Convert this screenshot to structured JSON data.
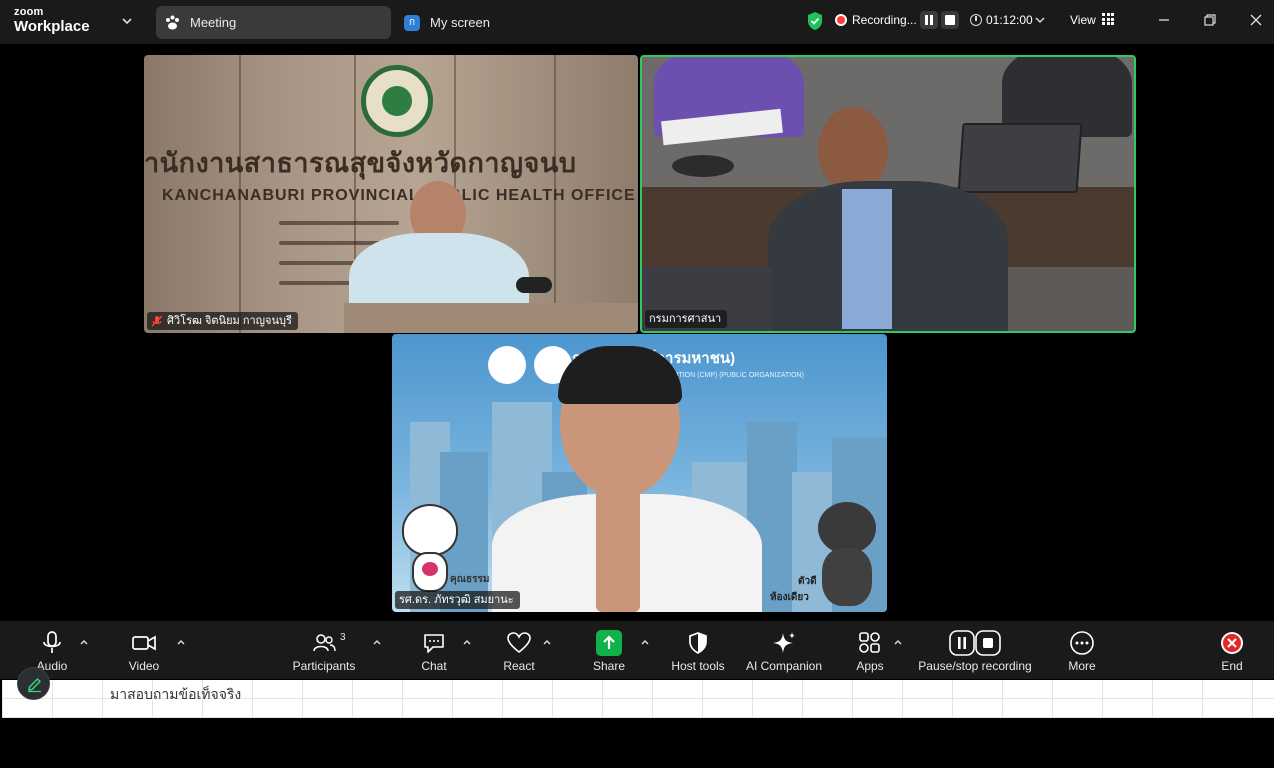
{
  "titlebar": {
    "brand_top": "zoom",
    "brand_bottom": "Workplace",
    "tabs": [
      {
        "label": "Meeting",
        "icon": "meeting-paw-icon",
        "active": true
      },
      {
        "label": "My screen",
        "icon": "my-screen-icon",
        "badge": "ก"
      }
    ],
    "recording_text": "Recording...",
    "timer": "01:12:00",
    "view_label": "View"
  },
  "tiles": [
    {
      "name": "ศิวิโรฒ จิตนิยม กาญจนบุรี",
      "muted": true,
      "wall_text_th": "านักงานสาธารณสุขจังหวัดกาญจนบ",
      "wall_text_en": "KANCHANABURI PROVINCIAL PUBLIC HEALTH OFFICE",
      "active_speaker": false
    },
    {
      "name": "กรมการศาสนา",
      "muted": false,
      "active_speaker": true
    },
    {
      "name": "รศ.ดร. ภัทรวุฒิ สมยานะ",
      "muted": false,
      "banner_text": "ก        ธรรม (องค์การมหาชน)",
      "banner_sub": "PROMOTION (CMP) (PUBLIC ORGANIZATION)",
      "mascot_left_caption": "คุณธรรม",
      "mascot_right_caption": "ตัวดี",
      "mascot_right_caption2": "ห้องเดียว",
      "active_speaker": false
    }
  ],
  "toolbar": {
    "buttons": [
      {
        "label": "Audio",
        "icon": "microphone-icon",
        "has_caret": true
      },
      {
        "label": "Video",
        "icon": "video-camera-icon",
        "has_caret": true
      },
      {
        "label": "Participants",
        "icon": "participants-icon",
        "count": "3",
        "has_caret": true
      },
      {
        "label": "Chat",
        "icon": "chat-icon",
        "has_caret": true
      },
      {
        "label": "React",
        "icon": "heart-icon",
        "has_caret": true
      },
      {
        "label": "Share",
        "icon": "share-arrow-icon",
        "has_caret": true
      },
      {
        "label": "Host tools",
        "icon": "shield-icon",
        "has_caret": false
      },
      {
        "label": "AI Companion",
        "icon": "sparkle-icon",
        "has_caret": false
      },
      {
        "label": "Apps",
        "icon": "apps-icon",
        "has_caret": true
      },
      {
        "label": "Pause/stop recording",
        "icon": "pause-stop-icon",
        "has_caret": false
      },
      {
        "label": "More",
        "icon": "more-dots-icon",
        "has_caret": false
      },
      {
        "label": "End",
        "icon": "end-x-icon",
        "has_caret": false
      }
    ]
  },
  "below": {
    "doc_text": "มาสอบถามข้อเท็จจริง"
  },
  "colors": {
    "active_speaker_border": "#33c763",
    "share_green": "#12b24a",
    "end_red": "#e02828",
    "toolbar_bg": "#1a1a1a"
  }
}
